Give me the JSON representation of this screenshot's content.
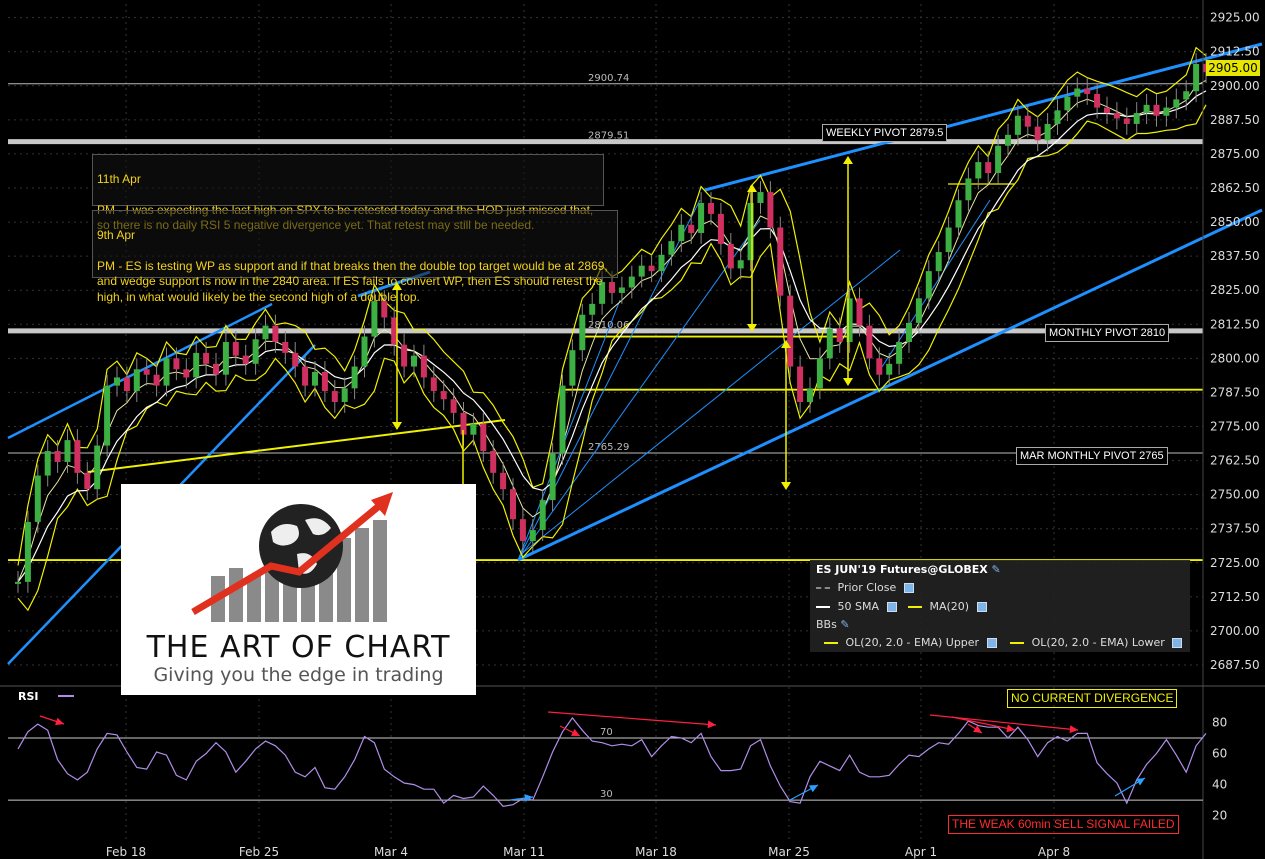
{
  "chart_data": {
    "type": "line",
    "title": "ES JUN'19 Futures@GLOBEX",
    "instrument": "ES JUN'19 Futures@GLOBEX",
    "timeframe_note": "60min",
    "price_axis": {
      "ylim": [
        2682,
        2930
      ],
      "ticks": [
        "2925.00",
        "2912.50",
        "2900.00",
        "2887.50",
        "2875.00",
        "2862.50",
        "2850.00",
        "2837.50",
        "2825.00",
        "2812.50",
        "2800.00",
        "2787.50",
        "2775.00",
        "2762.50",
        "2750.00",
        "2737.50",
        "2725.00",
        "2712.50",
        "2700.00",
        "2687.50"
      ],
      "last_price": "2905.00"
    },
    "x_ticks": [
      "Feb 18",
      "Feb 25",
      "Mar 4",
      "Mar 11",
      "Mar 18",
      "Mar 25",
      "Apr 1",
      "Apr 8"
    ],
    "price_series": {
      "name": "ES",
      "x_days": [
        0,
        1,
        2,
        3,
        4,
        5,
        6,
        7,
        8,
        9,
        10,
        11,
        12,
        13,
        14,
        15,
        16,
        17,
        18,
        19,
        20,
        21,
        22,
        23,
        24,
        25,
        26,
        27,
        28,
        29,
        30,
        31,
        32,
        33,
        34,
        35,
        36,
        37,
        38,
        39,
        40,
        41,
        42,
        43,
        44,
        45,
        46,
        47,
        48,
        49,
        50,
        51,
        52,
        53,
        54,
        55,
        56,
        57,
        58,
        59,
        60,
        61,
        62,
        63,
        64,
        65,
        66,
        67,
        68,
        69,
        70,
        71,
        72,
        73,
        74,
        75,
        76,
        77,
        78,
        79,
        80,
        81,
        82,
        83,
        84,
        85,
        86,
        87,
        88,
        89,
        90,
        91,
        92,
        93,
        94,
        95,
        96,
        97,
        98,
        99,
        100,
        101,
        102,
        103,
        104,
        105,
        106,
        107,
        108,
        109,
        110,
        111,
        112,
        113,
        114,
        115,
        116,
        117,
        118,
        119,
        120
      ],
      "values": [
        2718,
        2740,
        2757,
        2766,
        2762,
        2770,
        2758,
        2752,
        2768,
        2790,
        2793,
        2788,
        2796,
        2794,
        2790,
        2800,
        2796,
        2793,
        2802,
        2798,
        2794,
        2806,
        2801,
        2798,
        2807,
        2812,
        2806,
        2802,
        2797,
        2790,
        2795,
        2788,
        2784,
        2789,
        2797,
        2808,
        2821,
        2815,
        2805,
        2797,
        2801,
        2793,
        2788,
        2785,
        2780,
        2772,
        2776,
        2766,
        2758,
        2752,
        2741,
        2733,
        2737,
        2748,
        2765,
        2790,
        2803,
        2816,
        2820,
        2828,
        2824,
        2826,
        2830,
        2834,
        2832,
        2838,
        2843,
        2849,
        2846,
        2857,
        2853,
        2842,
        2833,
        2836,
        2857,
        2861,
        2848,
        2823,
        2797,
        2784,
        2789,
        2800,
        2811,
        2806,
        2822,
        2812,
        2800,
        2794,
        2798,
        2806,
        2813,
        2822,
        2832,
        2839,
        2848,
        2858,
        2866,
        2872,
        2868,
        2878,
        2882,
        2889,
        2885,
        2880,
        2886,
        2891,
        2896,
        2899,
        2897,
        2892,
        2890,
        2888,
        2886,
        2890,
        2893,
        2889,
        2892,
        2895,
        2898,
        2908,
        2905
      ]
    },
    "levels": [
      {
        "name": "Prior Close",
        "value": 2900.74,
        "label": "2900.74"
      },
      {
        "name": "WEEKLY PIVOT",
        "value": 2879.51,
        "label": "2879.51",
        "box": "WEEKLY PIVOT 2879.5"
      },
      {
        "name": "MONTHLY PIVOT",
        "value": 2810.06,
        "label": "2810.06",
        "box": "MONTHLY PIVOT 2810"
      },
      {
        "name": "MAR MONTHLY PIVOT",
        "value": 2765.29,
        "label": "2765.29",
        "box": "MAR MONTHLY PIVOT 2765"
      },
      {
        "name": "support",
        "value": 2726
      },
      {
        "name": "support",
        "value": 2788.5
      },
      {
        "name": "support",
        "value": 2808
      }
    ],
    "rsi": {
      "label": "RSI",
      "ylim": [
        12,
        90
      ],
      "ticks": [
        "80",
        "60",
        "40",
        "20"
      ],
      "levels": [
        "70",
        "30"
      ],
      "values": [
        60,
        76,
        78,
        72,
        58,
        46,
        40,
        50,
        62,
        70,
        74,
        60,
        48,
        52,
        60,
        56,
        48,
        42,
        52,
        62,
        66,
        58,
        50,
        54,
        60,
        70,
        64,
        56,
        50,
        44,
        48,
        40,
        36,
        42,
        58,
        70,
        64,
        52,
        44,
        38,
        42,
        36,
        34,
        30,
        32,
        28,
        34,
        38,
        30,
        28,
        26,
        28,
        32,
        44,
        58,
        76,
        82,
        72,
        70,
        66,
        62,
        68,
        64,
        66,
        60,
        64,
        68,
        72,
        66,
        70,
        60,
        48,
        46,
        52,
        64,
        66,
        54,
        38,
        26,
        30,
        44,
        52,
        54,
        48,
        56,
        50,
        44,
        42,
        48,
        52,
        56,
        60,
        62,
        64,
        68,
        72,
        78,
        80,
        76,
        74,
        72,
        76,
        66,
        60,
        66,
        68,
        70,
        72,
        70,
        56,
        46,
        38,
        30,
        42,
        50,
        62,
        68,
        56,
        50,
        64,
        70
      ]
    }
  },
  "notes": [
    {
      "date": "11th Apr",
      "text": "PM - I was expecting the last high on SPX to be retested today and the HOD just missed that, so there is no daily RSI 5 negative divergence yet. That retest may still be needed."
    },
    {
      "date": "9th Apr",
      "text": "PM - ES is testing WP as support and if that breaks then the double top target would be at 2869, and wedge support is now in the 2840 area. If ES fails to convert WP, then ES should retest the high, in what would likely be the second high of a double top."
    }
  ],
  "legend": {
    "title": "ES JUN'19 Futures@GLOBEX",
    "prior_close": "Prior Close",
    "sma": "50 SMA",
    "ma20": "MA(20)",
    "bbs": "BBs",
    "upper": "OL(20, 2.0 - EMA) Upper",
    "lower": "OL(20, 2.0 - EMA) Lower"
  },
  "flags": {
    "divergence": "NO CURRENT DIVERGENCE",
    "signal": "THE WEAK 60min SELL SIGNAL FAILED"
  },
  "logo": {
    "line1": "THE ART OF CHART",
    "line2": "Giving you the edge in trading"
  },
  "colors": {
    "trend": "#1e90ff",
    "support": "#f0f000",
    "pivot": "#c8c8c8",
    "rsi": "#b08ee8",
    "arrow_red": "#ff2040",
    "arrow_blue": "#2aa0ff",
    "signal_red": "#ff2b2b"
  }
}
